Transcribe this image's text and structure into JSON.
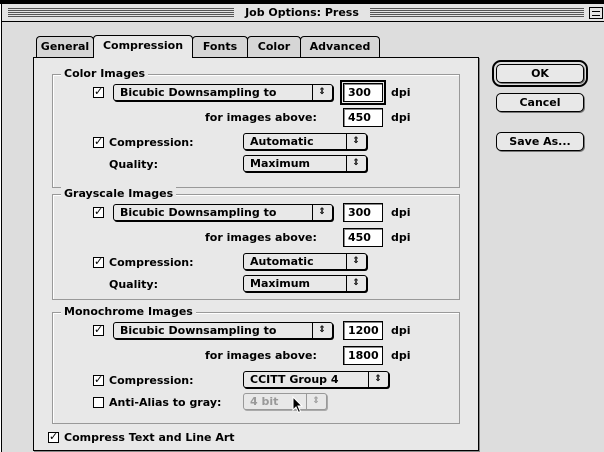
{
  "window": {
    "title": "Job Options: Press"
  },
  "tabs": [
    {
      "label": "General",
      "active": false
    },
    {
      "label": "Compression",
      "active": true
    },
    {
      "label": "Fonts",
      "active": false
    },
    {
      "label": "Color",
      "active": false
    },
    {
      "label": "Advanced",
      "active": false
    }
  ],
  "buttons": {
    "ok": "OK",
    "cancel": "Cancel",
    "save_as": "Save As..."
  },
  "color": {
    "title": "Color Images",
    "downsample_checked": true,
    "downsample_method": "Bicubic Downsampling to",
    "resolution": "300",
    "unit": "dpi",
    "above_label": "for images above:",
    "above_value": "450",
    "compression_checked": true,
    "compression_label": "Compression:",
    "compression_value": "Automatic",
    "quality_label": "Quality:",
    "quality_value": "Maximum"
  },
  "grayscale": {
    "title": "Grayscale Images",
    "downsample_checked": true,
    "downsample_method": "Bicubic Downsampling to",
    "resolution": "300",
    "unit": "dpi",
    "above_label": "for images above:",
    "above_value": "450",
    "compression_checked": true,
    "compression_label": "Compression:",
    "compression_value": "Automatic",
    "quality_label": "Quality:",
    "quality_value": "Maximum"
  },
  "mono": {
    "title": "Monochrome Images",
    "downsample_checked": true,
    "downsample_method": "Bicubic Downsampling to",
    "resolution": "1200",
    "unit": "dpi",
    "above_label": "for images above:",
    "above_value": "1800",
    "compression_checked": true,
    "compression_label": "Compression:",
    "compression_value": "CCITT Group 4",
    "antialias_checked": false,
    "antialias_label": "Anti-Alias to gray:",
    "antialias_value": "4 bit"
  },
  "compress_text": {
    "checked": true,
    "label": "Compress Text and Line Art"
  },
  "icons": {
    "popup_arrow": "⇕",
    "check": "✓",
    "cursor": "arrow-pointer"
  }
}
